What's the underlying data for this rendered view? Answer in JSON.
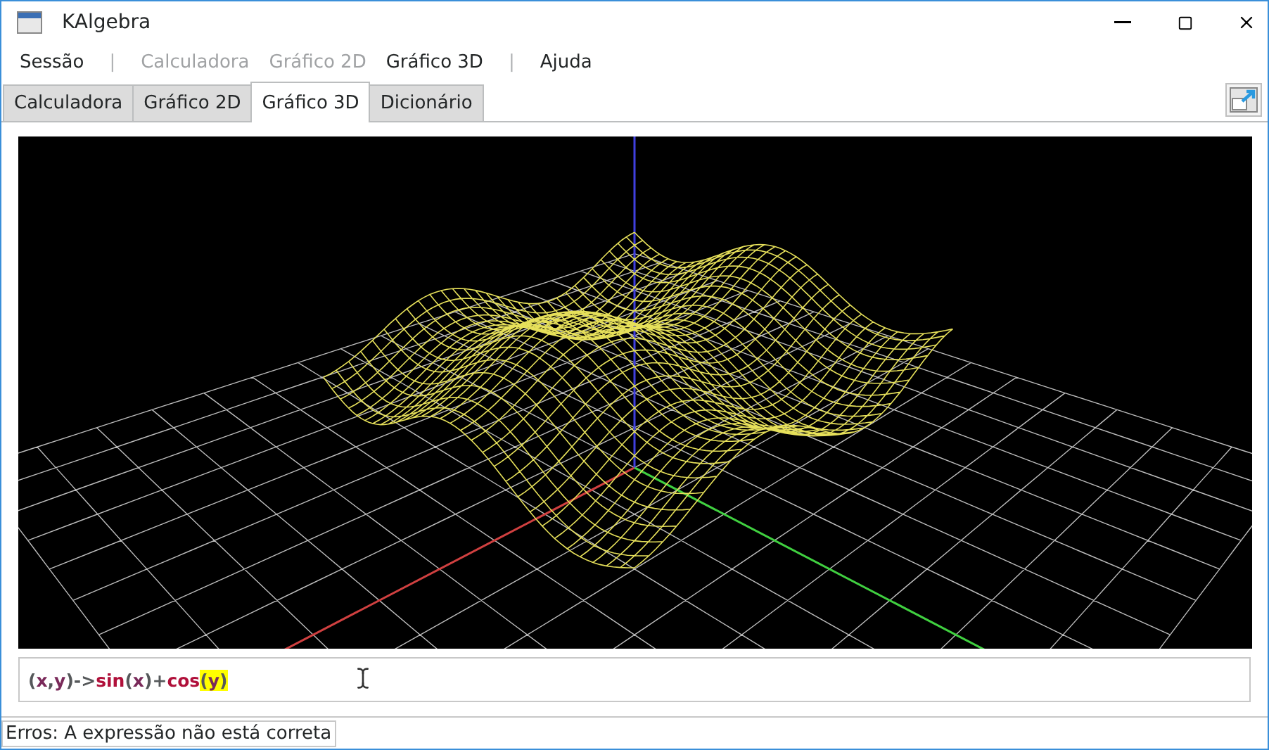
{
  "window": {
    "title": "KAlgebra"
  },
  "menu": [
    {
      "kind": "item",
      "label": "Sessão",
      "disabled": false
    },
    {
      "kind": "separator",
      "label": "|"
    },
    {
      "kind": "item",
      "label": "Calculadora",
      "disabled": true
    },
    {
      "kind": "item",
      "label": "Gráfico 2D",
      "disabled": true
    },
    {
      "kind": "item",
      "label": "Gráfico 3D",
      "disabled": false
    },
    {
      "kind": "separator",
      "label": "|"
    },
    {
      "kind": "item",
      "label": "Ajuda",
      "disabled": false
    }
  ],
  "tabs": [
    {
      "label": "Calculadora",
      "selected": false
    },
    {
      "label": "Gráfico 2D",
      "selected": false
    },
    {
      "label": "Gráfico 3D",
      "selected": true
    },
    {
      "label": "Dicionário",
      "selected": false
    }
  ],
  "expression": {
    "tokens": [
      {
        "kind": "op",
        "text": "(",
        "highlighted": false
      },
      {
        "kind": "var",
        "text": "x",
        "highlighted": false
      },
      {
        "kind": "op",
        "text": ",",
        "highlighted": false
      },
      {
        "kind": "var",
        "text": "y",
        "highlighted": false
      },
      {
        "kind": "op",
        "text": ")->",
        "highlighted": false
      },
      {
        "kind": "func",
        "text": "sin",
        "highlighted": false
      },
      {
        "kind": "op",
        "text": "(",
        "highlighted": false
      },
      {
        "kind": "var",
        "text": "x",
        "highlighted": false
      },
      {
        "kind": "op",
        "text": ")+",
        "highlighted": false
      },
      {
        "kind": "func",
        "text": "cos",
        "highlighted": false
      },
      {
        "kind": "op",
        "text": "(",
        "highlighted": true
      },
      {
        "kind": "var",
        "text": "y",
        "highlighted": true
      },
      {
        "kind": "op",
        "text": ")",
        "highlighted": true
      }
    ]
  },
  "status_bar": {
    "message": "Erros: A expressão não está correta"
  }
}
